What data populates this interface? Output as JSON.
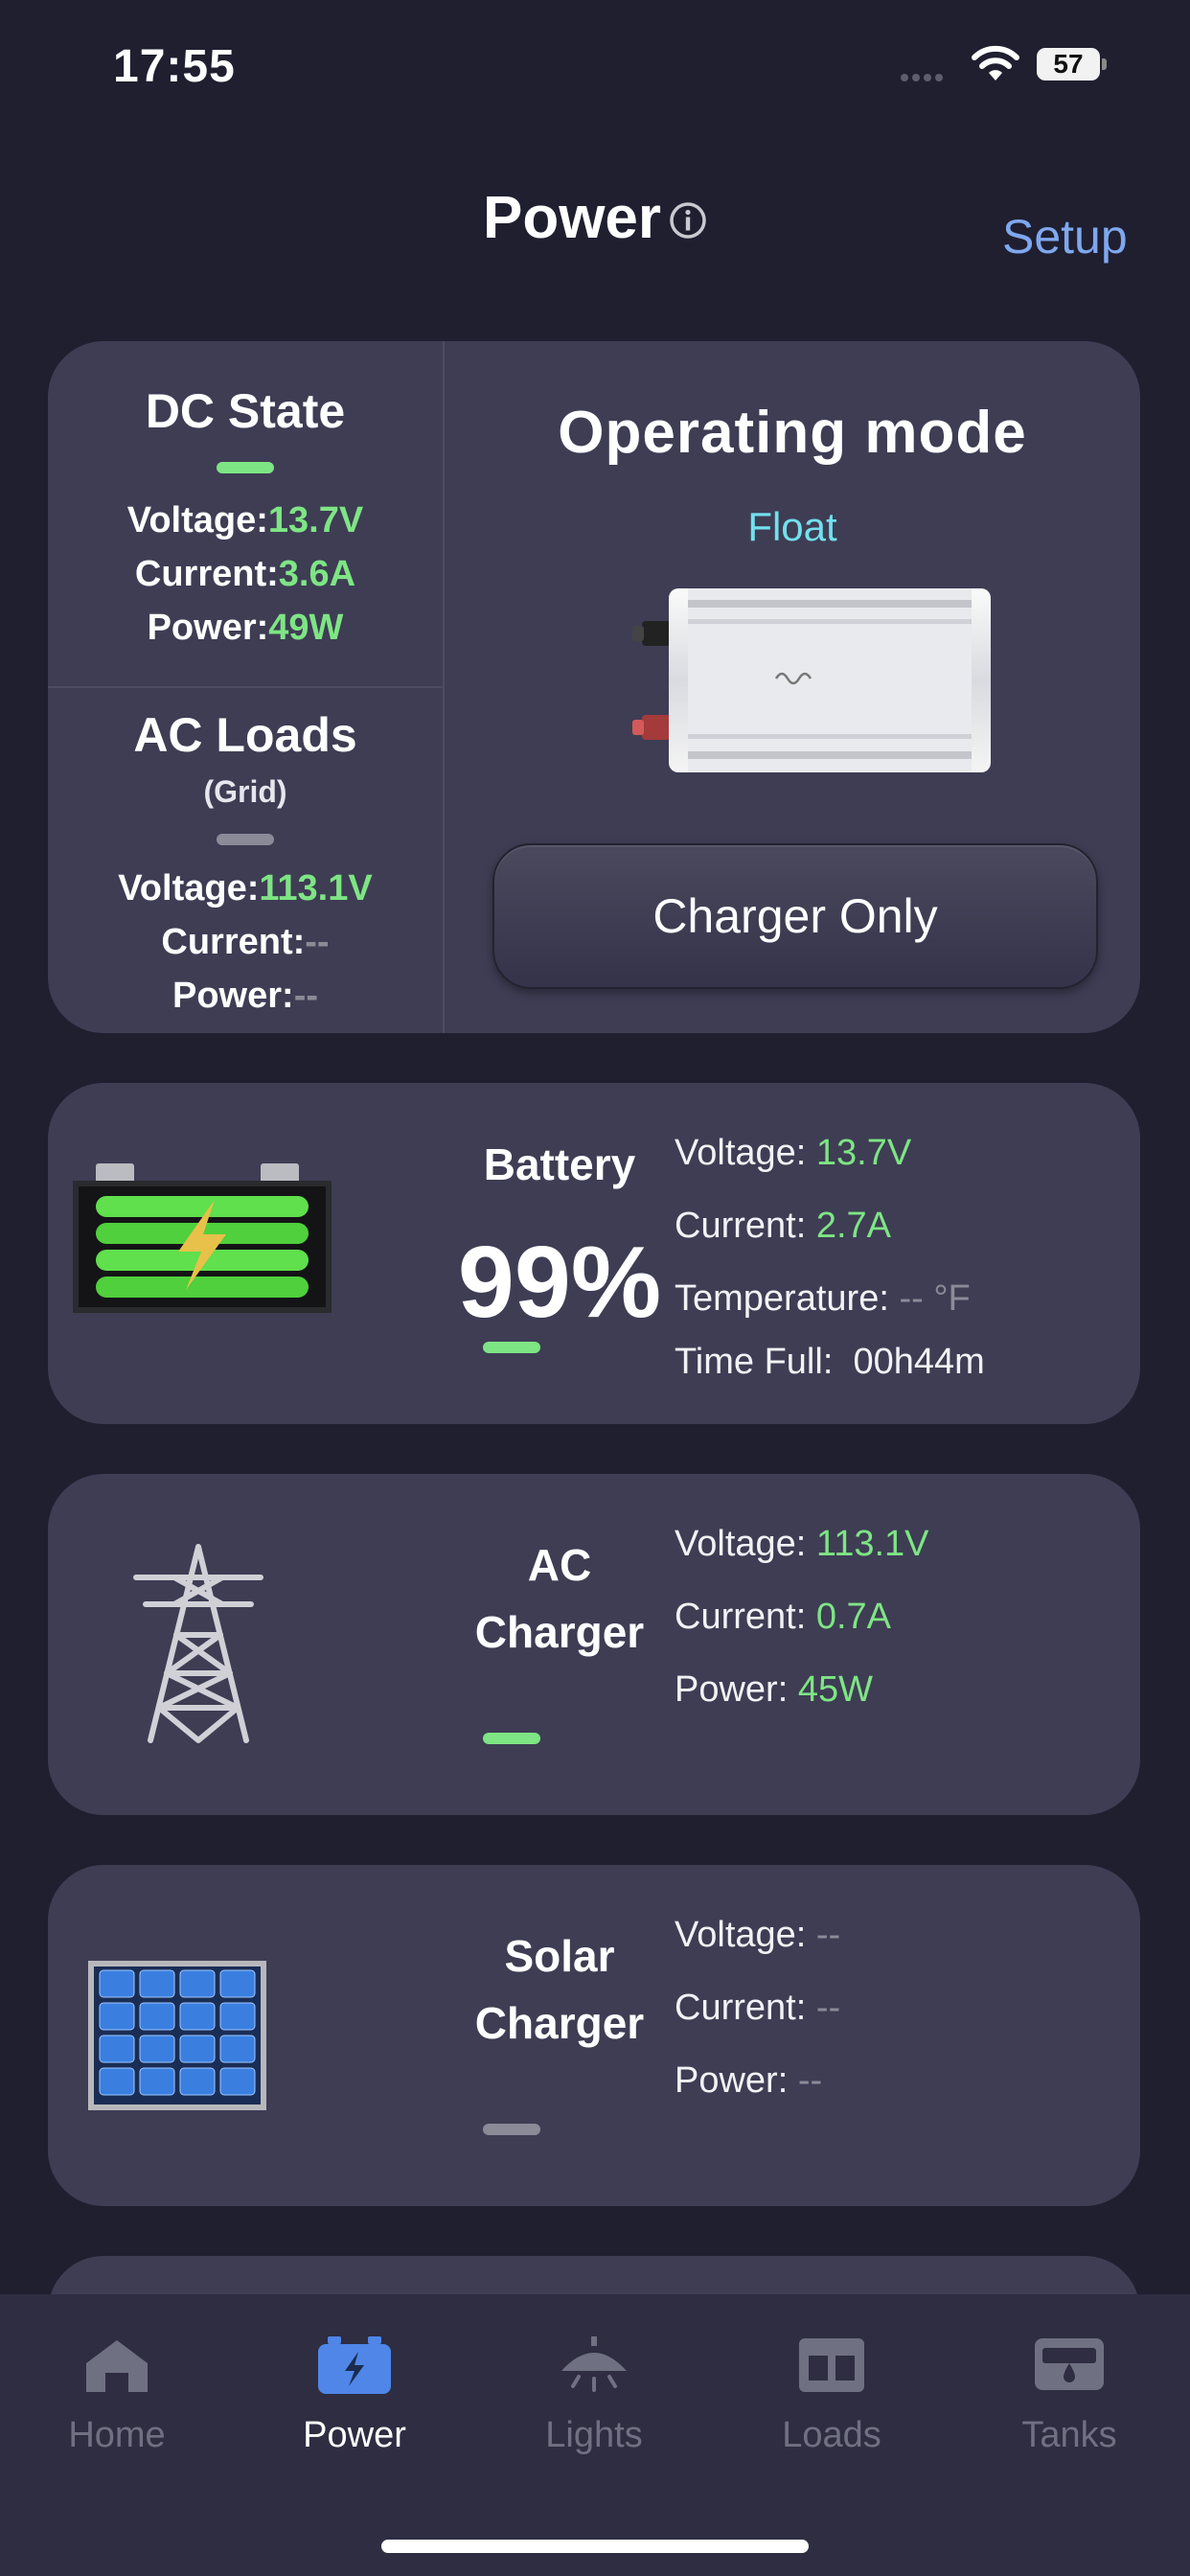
{
  "status_bar": {
    "time": "17:55",
    "battery_level": "57"
  },
  "header": {
    "title": "Power",
    "setup_label": "Setup"
  },
  "dc_state": {
    "title": "DC State",
    "voltage_label": "Voltage:",
    "voltage": "13.7V",
    "current_label": "Current:",
    "current": "3.6A",
    "power_label": "Power:",
    "power": "49W"
  },
  "ac_loads": {
    "title": "AC Loads",
    "subtitle": "(Grid)",
    "voltage_label": "Voltage:",
    "voltage": "113.1V",
    "current_label": "Current:",
    "current": "--",
    "power_label": "Power:",
    "power": "--"
  },
  "operating_mode": {
    "title": "Operating mode",
    "value": "Float",
    "button_label": "Charger Only"
  },
  "battery": {
    "name": "Battery",
    "percent": "99%",
    "voltage_label": "Voltage:",
    "voltage": "13.7V",
    "current_label": "Current:",
    "current": "2.7A",
    "temperature_label": "Temperature:",
    "temperature": "-- °F",
    "time_full_label": "Time Full:",
    "time_full": "00h44m"
  },
  "ac_charger": {
    "name_line1": "AC",
    "name_line2": "Charger",
    "voltage_label": "Voltage:",
    "voltage": "113.1V",
    "current_label": "Current:",
    "current": "0.7A",
    "power_label": "Power:",
    "power": "45W"
  },
  "solar_charger": {
    "name_line1": "Solar",
    "name_line2": "Charger",
    "voltage_label": "Voltage:",
    "voltage": "--",
    "current_label": "Current:",
    "current": "--",
    "power_label": "Power:",
    "power": "--"
  },
  "tabs": [
    {
      "label": "Home",
      "icon": "home-icon"
    },
    {
      "label": "Power",
      "icon": "battery-icon"
    },
    {
      "label": "Lights",
      "icon": "ceiling-light-icon"
    },
    {
      "label": "Loads",
      "icon": "panel-icon"
    },
    {
      "label": "Tanks",
      "icon": "tank-icon"
    }
  ],
  "colors": {
    "accent_green": "#7ee584",
    "link_blue": "#7fa8ee",
    "float_cyan": "#72e0ee",
    "card": "#3e3d54",
    "background": "#1f1f30"
  }
}
